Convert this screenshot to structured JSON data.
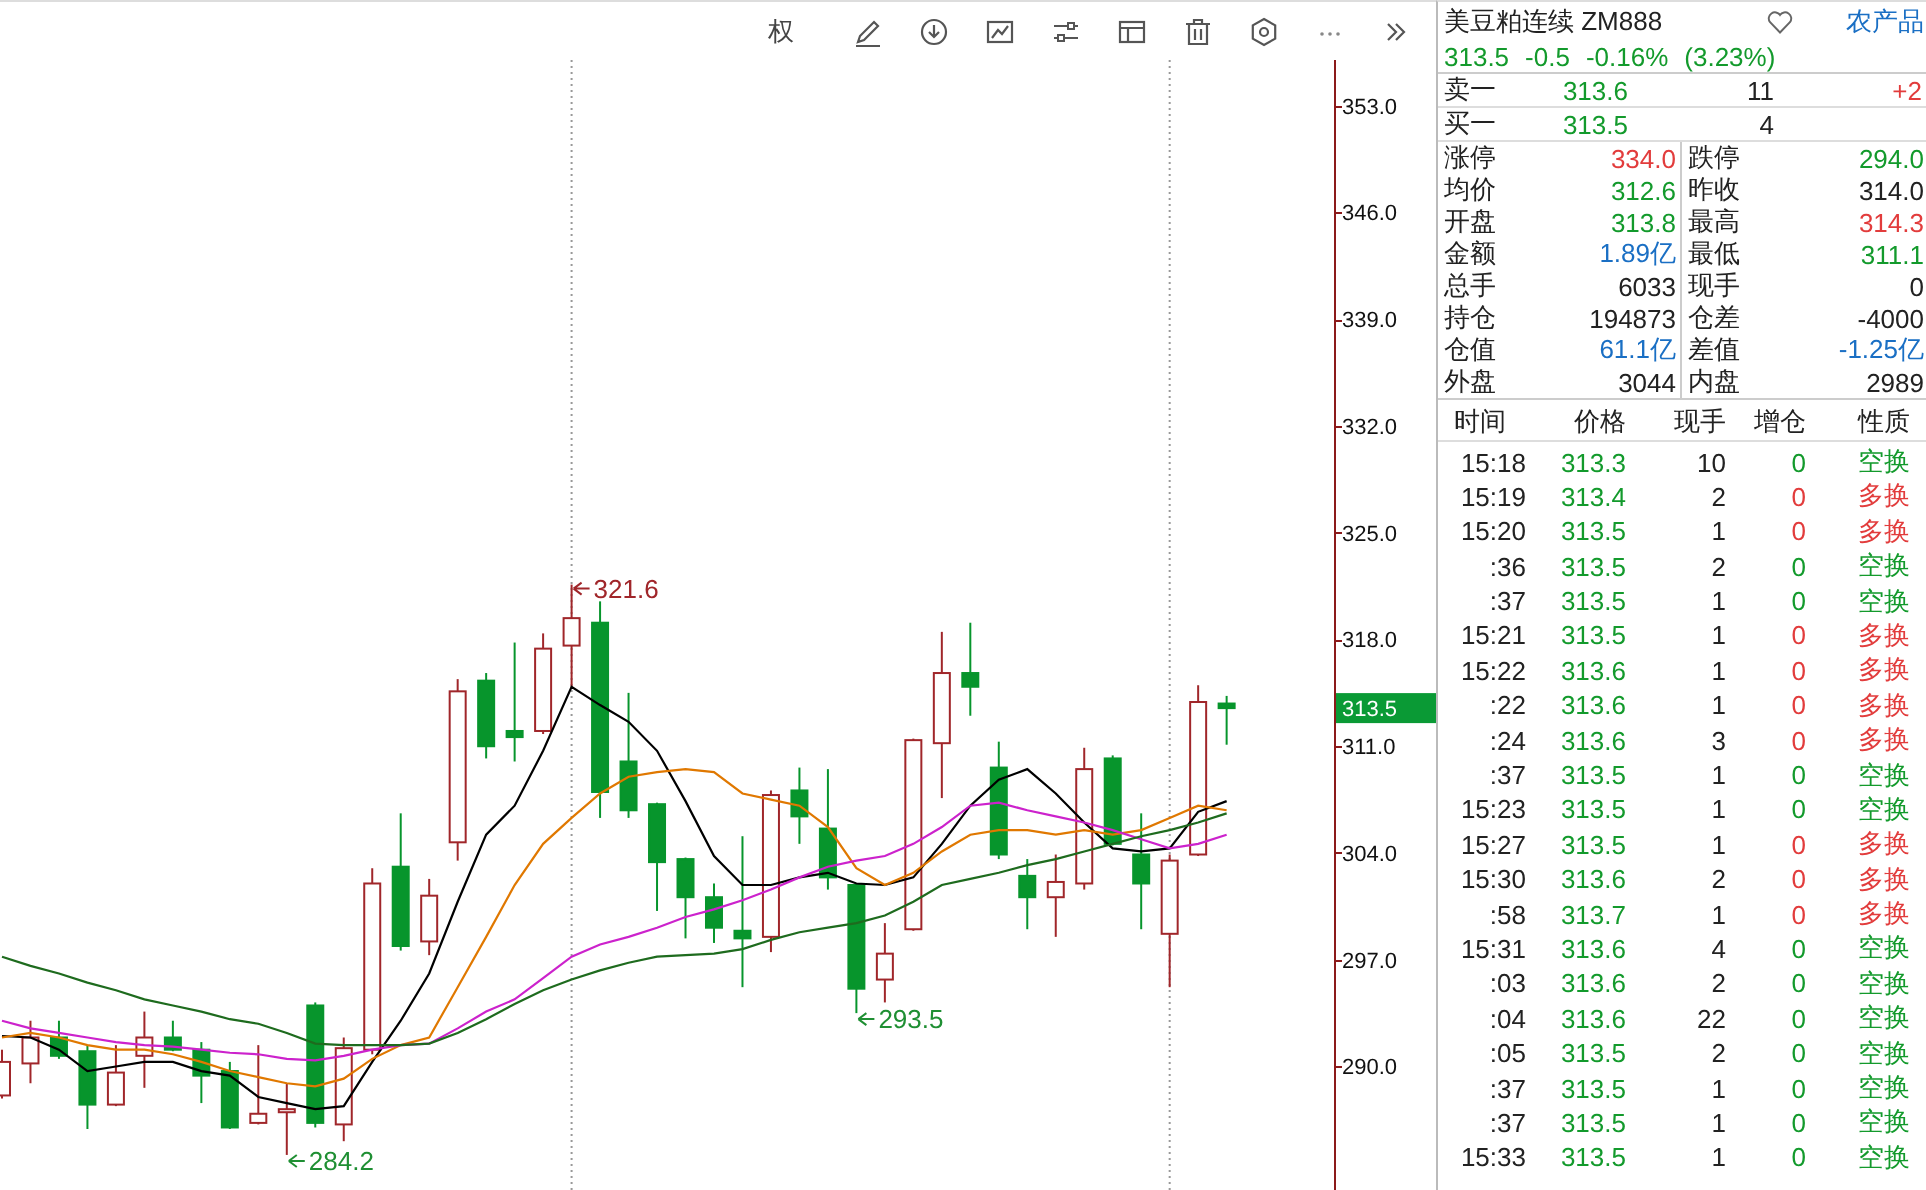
{
  "toolbar": {
    "items": [
      {
        "kind": "text",
        "label": "权"
      },
      {
        "kind": "pencil"
      },
      {
        "kind": "download"
      },
      {
        "kind": "picture"
      },
      {
        "kind": "sliders"
      },
      {
        "kind": "layout"
      },
      {
        "kind": "trash"
      },
      {
        "kind": "settings"
      },
      {
        "kind": "more"
      },
      {
        "kind": "expand"
      }
    ]
  },
  "chart": {
    "chart_data": {
      "type": "candlestick",
      "categories": [
        null,
        null,
        null,
        null,
        null,
        null,
        null,
        null,
        null,
        null,
        null,
        null,
        null,
        null,
        null,
        null,
        null,
        null,
        null,
        null,
        null,
        null,
        null,
        null,
        null,
        null,
        null,
        null,
        null,
        null,
        null,
        null,
        null,
        null,
        null,
        null,
        null,
        null,
        null,
        null,
        null,
        null,
        null,
        null
      ],
      "ylim": [
        281.9,
        356
      ],
      "yticks": [
        {
          "value": 353,
          "label": "353.0"
        },
        {
          "value": 346,
          "label": "346.0"
        },
        {
          "value": 339,
          "label": "339.0"
        },
        {
          "value": 332,
          "label": "332.0"
        },
        {
          "value": 325,
          "label": "325.0"
        },
        {
          "value": 318,
          "label": "318.0"
        },
        {
          "value": 311,
          "label": "311.0"
        },
        {
          "value": 304,
          "label": "304.0"
        },
        {
          "value": 297,
          "label": "297.0"
        },
        {
          "value": 290,
          "label": "290.0"
        }
      ],
      "ohlc": [
        [
          288.1,
          291.1,
          287.9,
          290.3
        ],
        [
          290.2,
          293.0,
          288.9,
          291.9
        ],
        [
          291.9,
          293.0,
          290.5,
          290.7
        ],
        [
          291.0,
          291.4,
          285.9,
          287.5
        ],
        [
          287.5,
          291.4,
          287.4,
          289.6
        ],
        [
          290.7,
          293.6,
          288.6,
          291.9
        ],
        [
          291.9,
          293.0,
          291.0,
          291.1
        ],
        [
          291.1,
          291.6,
          287.6,
          289.4
        ],
        [
          289.7,
          290.3,
          285.9,
          286.0
        ],
        [
          286.3,
          291.4,
          286.2,
          286.9
        ],
        [
          287.0,
          288.9,
          284.2,
          287.2
        ],
        [
          294.0,
          294.2,
          286.0,
          286.3
        ],
        [
          286.2,
          291.9,
          285.1,
          291.2
        ],
        [
          291.1,
          303.0,
          290.8,
          302.0
        ],
        [
          303.1,
          306.6,
          297.6,
          297.9
        ],
        [
          298.2,
          302.3,
          297.3,
          301.2
        ],
        [
          304.7,
          315.4,
          303.5,
          314.6
        ],
        [
          315.3,
          315.8,
          310.2,
          311.0
        ],
        [
          312.0,
          317.8,
          310.0,
          311.6
        ],
        [
          312.0,
          318.4,
          311.8,
          317.4
        ],
        [
          317.6,
          321.6,
          314.9,
          319.4
        ],
        [
          319.1,
          320.5,
          306.3,
          308.0
        ],
        [
          310.0,
          314.5,
          306.3,
          306.8
        ],
        [
          307.2,
          307.3,
          300.2,
          303.4
        ],
        [
          303.6,
          303.7,
          298.4,
          301.1
        ],
        [
          301.1,
          302.0,
          298.1,
          299.1
        ],
        [
          298.9,
          305.1,
          295.2,
          298.4
        ],
        [
          298.5,
          308.1,
          297.5,
          307.8
        ],
        [
          308.1,
          309.6,
          304.6,
          306.4
        ],
        [
          305.6,
          309.5,
          301.6,
          302.4
        ],
        [
          301.9,
          302.0,
          293.5,
          295.1
        ],
        [
          295.7,
          299.4,
          294.2,
          297.4
        ],
        [
          299.0,
          311.5,
          298.9,
          311.4
        ],
        [
          311.2,
          318.5,
          307.6,
          315.8
        ],
        [
          315.8,
          319.1,
          313.0,
          314.9
        ],
        [
          309.6,
          311.3,
          303.6,
          303.9
        ],
        [
          302.5,
          303.6,
          299.0,
          301.1
        ],
        [
          301.1,
          303.9,
          298.5,
          302.1
        ],
        [
          302.0,
          310.9,
          301.6,
          309.5
        ],
        [
          310.2,
          310.4,
          304.5,
          304.6
        ],
        [
          303.9,
          306.6,
          299.0,
          302.0
        ],
        [
          298.7,
          303.9,
          295.2,
          303.5
        ],
        [
          303.9,
          315.0,
          303.8,
          313.9
        ],
        [
          313.8,
          314.3,
          311.1,
          313.5
        ]
      ],
      "series": [
        {
          "type": "line",
          "color": "#000000",
          "values": [
            292.0,
            291.9,
            291.1,
            289.7,
            290.0,
            290.3,
            290.3,
            289.7,
            289.4,
            288.0,
            287.6,
            287.2,
            287.4,
            290.3,
            293.0,
            296.1,
            300.8,
            305.2,
            307.1,
            310.7,
            314.9,
            313.7,
            312.6,
            310.7,
            307.4,
            303.8,
            301.9,
            301.9,
            302.4,
            302.7,
            302.0,
            301.9,
            302.4,
            304.6,
            307.1,
            308.8,
            309.5,
            307.9,
            306.0,
            304.3,
            304.1,
            304.3,
            306.7,
            307.4
          ]
        },
        {
          "type": "line",
          "color": "#e07800",
          "values": [
            291.9,
            292.2,
            291.9,
            291.4,
            291.1,
            291.1,
            290.8,
            290.3,
            289.7,
            289.3,
            288.9,
            288.7,
            289.2,
            290.5,
            291.4,
            291.9,
            295.2,
            298.5,
            301.9,
            304.6,
            306.3,
            307.9,
            309.0,
            309.3,
            309.5,
            309.3,
            307.9,
            307.5,
            307.1,
            305.7,
            303.0,
            301.9,
            302.7,
            304.1,
            305.2,
            305.5,
            305.5,
            305.2,
            305.5,
            305.2,
            305.5,
            306.3,
            307.1,
            306.8
          ]
        },
        {
          "type": "line",
          "color": "#cc22cc",
          "values": [
            293.0,
            292.5,
            292.2,
            291.9,
            291.6,
            291.4,
            291.3,
            291.1,
            290.9,
            290.8,
            290.5,
            290.4,
            290.7,
            291.1,
            291.4,
            291.5,
            292.5,
            293.6,
            294.4,
            295.8,
            297.2,
            298.0,
            298.5,
            299.1,
            299.8,
            300.3,
            300.9,
            301.6,
            302.4,
            303.1,
            303.5,
            303.8,
            304.6,
            305.7,
            307.1,
            307.3,
            306.8,
            306.4,
            306.0,
            305.5,
            304.9,
            304.3,
            304.6,
            305.2
          ]
        },
        {
          "type": "line",
          "color": "#1e6b1e",
          "values": [
            297.2,
            296.6,
            296.1,
            295.5,
            295.0,
            294.4,
            294.0,
            293.6,
            293.1,
            292.8,
            292.2,
            291.5,
            291.4,
            291.4,
            291.4,
            291.5,
            292.2,
            293.1,
            294.1,
            295.0,
            295.7,
            296.3,
            296.8,
            297.2,
            297.3,
            297.4,
            297.7,
            298.3,
            298.8,
            299.1,
            299.4,
            299.9,
            300.8,
            301.9,
            302.3,
            302.7,
            303.2,
            303.6,
            304.1,
            304.6,
            305.1,
            305.5,
            306.0,
            306.6
          ]
        }
      ],
      "annotations": [
        "321.6",
        "284.2",
        "293.5",
        "313.5"
      ]
    }
  },
  "quote": {
    "title": "美豆粕连续 ZM888",
    "category": "农产品",
    "kind": "down",
    "last": "313.5",
    "change": "-0.5",
    "change_pct": "-0.16%",
    "extra": "(3.23%)"
  },
  "order_book": [
    {
      "label": "卖一",
      "price": "313.6",
      "volume": "11",
      "change": "+2"
    },
    {
      "label": "买一",
      "price": "313.5",
      "volume": "4"
    }
  ],
  "stats": [
    {
      "label": "涨停",
      "value": "334.0",
      "kind": "up"
    },
    {
      "label": "跌停",
      "value": "294.0",
      "kind": "down"
    },
    {
      "label": "均价",
      "value": "312.6",
      "kind": "down"
    },
    {
      "label": "昨收",
      "value": "314.0",
      "kind": "flat"
    },
    {
      "label": "开盘",
      "value": "313.8",
      "kind": "down"
    },
    {
      "label": "最高",
      "value": "314.3",
      "kind": "up"
    },
    {
      "label": "金额",
      "value": "1.89亿",
      "kind": "amount"
    },
    {
      "label": "最低",
      "value": "311.1",
      "kind": "down"
    },
    {
      "label": "总手",
      "value": "6033",
      "kind": "flat"
    },
    {
      "label": "现手",
      "value": "0",
      "kind": "flat"
    },
    {
      "label": "持仓",
      "value": "194873",
      "kind": "flat"
    },
    {
      "label": "仓差",
      "value": "-4000",
      "kind": "flat"
    },
    {
      "label": "仓值",
      "value": "61.1亿",
      "kind": "amount"
    },
    {
      "label": "差值",
      "value": "-1.25亿",
      "kind": "amount"
    },
    {
      "label": "外盘",
      "value": "3044",
      "kind": "flat"
    },
    {
      "label": "内盘",
      "value": "2989",
      "kind": "flat"
    }
  ],
  "trades": {
    "columns": [
      "时间",
      "价格",
      "现手",
      "增仓",
      "性质"
    ],
    "rows": [
      {
        "time": "15:18",
        "price": "313.3",
        "volume": "10",
        "oi_change": "0",
        "nature": "空换",
        "kind": "short"
      },
      {
        "time": "15:19",
        "price": "313.4",
        "volume": "2",
        "oi_change": "0",
        "nature": "多换",
        "kind": "long"
      },
      {
        "time": "15:20",
        "price": "313.5",
        "volume": "1",
        "oi_change": "0",
        "nature": "多换",
        "kind": "long"
      },
      {
        "time": ":36",
        "price": "313.5",
        "volume": "2",
        "oi_change": "0",
        "nature": "空换",
        "kind": "short"
      },
      {
        "time": ":37",
        "price": "313.5",
        "volume": "1",
        "oi_change": "0",
        "nature": "空换",
        "kind": "short"
      },
      {
        "time": "15:21",
        "price": "313.5",
        "volume": "1",
        "oi_change": "0",
        "nature": "多换",
        "kind": "long"
      },
      {
        "time": "15:22",
        "price": "313.6",
        "volume": "1",
        "oi_change": "0",
        "nature": "多换",
        "kind": "long"
      },
      {
        "time": ":22",
        "price": "313.6",
        "volume": "1",
        "oi_change": "0",
        "nature": "多换",
        "kind": "long"
      },
      {
        "time": ":24",
        "price": "313.6",
        "volume": "3",
        "oi_change": "0",
        "nature": "多换",
        "kind": "long"
      },
      {
        "time": ":37",
        "price": "313.5",
        "volume": "1",
        "oi_change": "0",
        "nature": "空换",
        "kind": "short"
      },
      {
        "time": "15:23",
        "price": "313.5",
        "volume": "1",
        "oi_change": "0",
        "nature": "空换",
        "kind": "short"
      },
      {
        "time": "15:27",
        "price": "313.5",
        "volume": "1",
        "oi_change": "0",
        "nature": "多换",
        "kind": "long"
      },
      {
        "time": "15:30",
        "price": "313.6",
        "volume": "2",
        "oi_change": "0",
        "nature": "多换",
        "kind": "long"
      },
      {
        "time": ":58",
        "price": "313.7",
        "volume": "1",
        "oi_change": "0",
        "nature": "多换",
        "kind": "long"
      },
      {
        "time": "15:31",
        "price": "313.6",
        "volume": "4",
        "oi_change": "0",
        "nature": "空换",
        "kind": "short"
      },
      {
        "time": ":03",
        "price": "313.6",
        "volume": "2",
        "oi_change": "0",
        "nature": "空换",
        "kind": "short"
      },
      {
        "time": ":04",
        "price": "313.6",
        "volume": "22",
        "oi_change": "0",
        "nature": "空换",
        "kind": "short"
      },
      {
        "time": ":05",
        "price": "313.5",
        "volume": "2",
        "oi_change": "0",
        "nature": "空换",
        "kind": "short"
      },
      {
        "time": ":37",
        "price": "313.5",
        "volume": "1",
        "oi_change": "0",
        "nature": "空换",
        "kind": "short"
      },
      {
        "time": ":37",
        "price": "313.5",
        "volume": "1",
        "oi_change": "0",
        "nature": "空换",
        "kind": "short"
      },
      {
        "time": "15:33",
        "price": "313.5",
        "volume": "1",
        "oi_change": "0",
        "nature": "空换",
        "kind": "short"
      }
    ]
  }
}
